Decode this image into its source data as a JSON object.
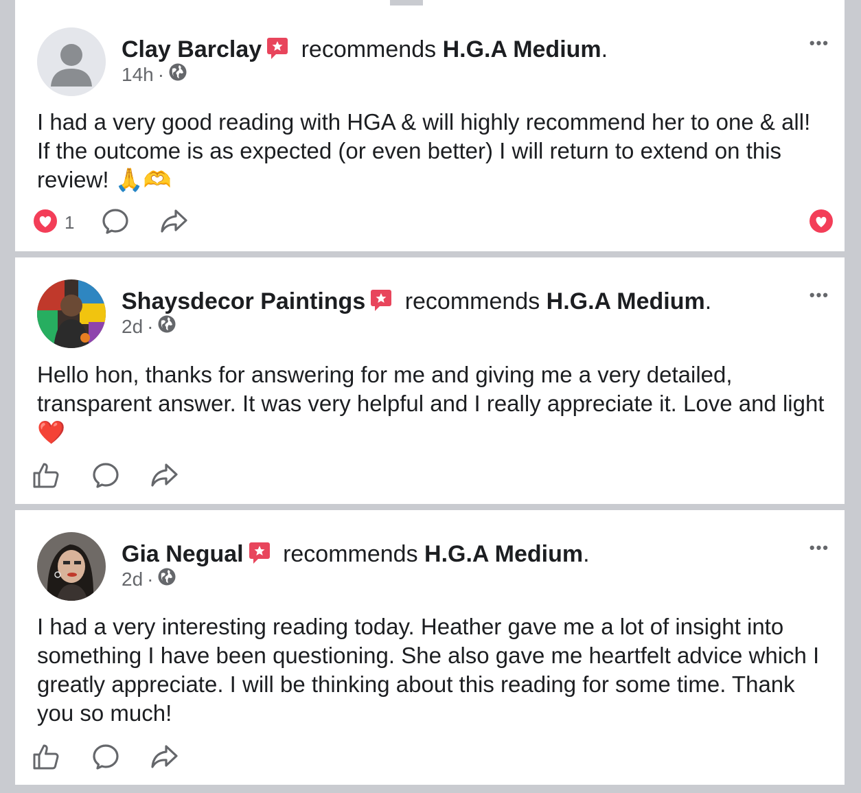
{
  "posts": [
    {
      "author": "Clay Barclay",
      "recommends_text": "recommends",
      "page_name": "H.G.A Medium",
      "time": "14h",
      "body": "I had a very good reading with HGA & will highly recommend her to one & all!  If the outcome is as expected (or even better) I will return to extend on this review!  🙏🫶",
      "reaction_count": "1",
      "avatar": "default-person-avatar",
      "reacted": true
    },
    {
      "author": "Shaysdecor Paintings",
      "recommends_text": "recommends",
      "page_name": "H.G.A Medium",
      "time": "2d",
      "body": "Hello hon, thanks for answering for me and giving me a very detailed, transparent answer. It was very helpful and I really appreciate it. Love and light❤️",
      "avatar": "photo-avatar",
      "reacted": false
    },
    {
      "author": "Gia Negual",
      "recommends_text": "recommends",
      "page_name": "H.G.A Medium",
      "time": "2d",
      "body": "I had a very interesting reading today. Heather gave me a lot of insight into something I have been questioning. She also gave me heartfelt advice which I greatly appreciate. I will be thinking about this reading for some time. Thank you so much!",
      "avatar": "photo-avatar",
      "reacted": false
    }
  ],
  "ui": {
    "more_label": "•••",
    "dot": "·",
    "period": "."
  },
  "colors": {
    "heart_red": "#f33e58",
    "badge_red": "#e8455c",
    "secondary_text": "#65676b"
  }
}
